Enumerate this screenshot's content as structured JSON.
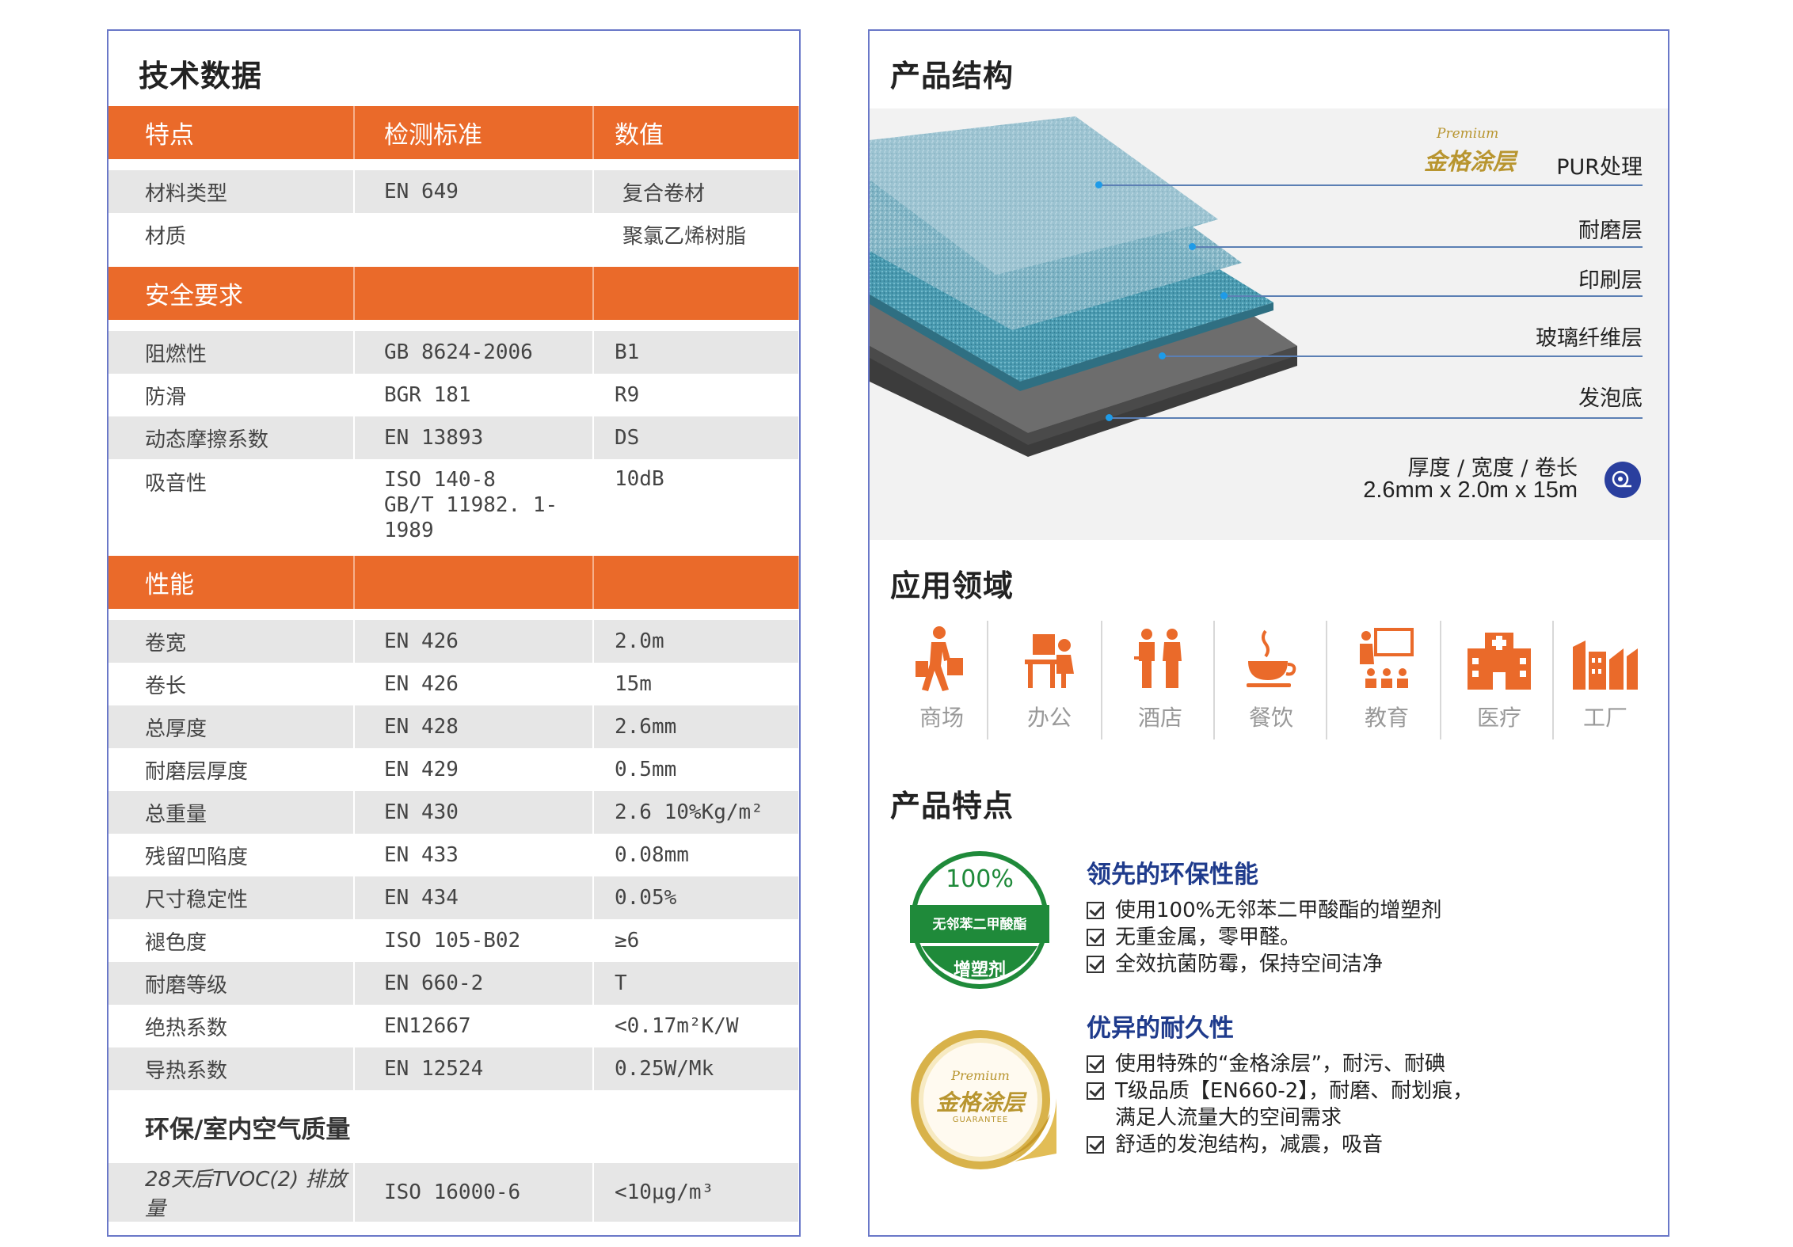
{
  "left": {
    "title": "技术数据",
    "header": [
      "特点",
      "检测标准",
      "数值"
    ],
    "material_rows": [
      {
        "feature": "材料类型",
        "standard": "EN 649",
        "value": "复合卷材"
      },
      {
        "feature": "材质",
        "standard": "",
        "value": "聚氯乙烯树脂"
      }
    ],
    "safety_title": "安全要求",
    "safety_rows": [
      {
        "feature": "阻燃性",
        "standard": "GB 8624-2006",
        "value": "B1"
      },
      {
        "feature": "防滑",
        "standard": "BGR 181",
        "value": "R9"
      },
      {
        "feature": "动态摩擦系数",
        "standard": "EN 13893",
        "value": "DS"
      },
      {
        "feature": "吸音性",
        "standard": "ISO 140-8",
        "standard2": "GB/T 11982. 1-1989",
        "value": "10dB"
      }
    ],
    "performance_title": "性能",
    "performance_rows": [
      {
        "feature": "卷宽",
        "standard": "EN 426",
        "value": "2.0m"
      },
      {
        "feature": "卷长",
        "standard": "EN 426",
        "value": "15m"
      },
      {
        "feature": "总厚度",
        "standard": "EN 428",
        "value": "2.6mm"
      },
      {
        "feature": "耐磨层厚度",
        "standard": "EN 429",
        "value": "0.5mm"
      },
      {
        "feature": "总重量",
        "standard": "EN 430",
        "value": "2.6  10%Kg/m²"
      },
      {
        "feature": "残留凹陷度",
        "standard": "EN 433",
        "value": "0.08mm"
      },
      {
        "feature": "尺寸稳定性",
        "standard": "EN 434",
        "value": "0.05%"
      },
      {
        "feature": "褪色度",
        "standard": "ISO 105-B02",
        "value": "≥6"
      },
      {
        "feature": "耐磨等级",
        "standard": "EN 660-2",
        "value": "T"
      },
      {
        "feature": "绝热系数",
        "standard": "EN12667",
        "value": "<0.17m²K/W"
      },
      {
        "feature": "导热系数",
        "standard": "EN 12524",
        "value": "0.25W/Mk"
      }
    ],
    "env_title": "环保/室内空气质量",
    "env_rows": [
      {
        "feature": "28天后TVOC(2) 排放量",
        "standard": "ISO 16000-6",
        "value": "<10μg/m³"
      }
    ]
  },
  "right": {
    "structure_title": "产品结构",
    "brand_latin": "Premium",
    "brand_cn": "金格涂层",
    "layers": [
      "PUR处理",
      "耐磨层",
      "印刷层",
      "玻璃纤维层",
      "发泡底"
    ],
    "dims_label": "厚度 / 宽度 / 卷长",
    "dims_value": "2.6mm x 2.0m x 15m",
    "application_title": "应用领域",
    "applications": [
      {
        "label": "商场",
        "icon": "shopping-icon"
      },
      {
        "label": "办公",
        "icon": "office-icon"
      },
      {
        "label": "酒店",
        "icon": "hotel-icon"
      },
      {
        "label": "餐饮",
        "icon": "dining-icon"
      },
      {
        "label": "教育",
        "icon": "education-icon"
      },
      {
        "label": "医疗",
        "icon": "hospital-icon"
      },
      {
        "label": "工厂",
        "icon": "factory-icon"
      }
    ],
    "features_title": "产品特点",
    "badge1": {
      "pct": "100%",
      "mid": "无邻苯二甲酸酯",
      "bottom": "增塑剂"
    },
    "badge2": {
      "latin": "Premium",
      "cn": "金格涂层",
      "small": "GUARANTEE"
    },
    "feature_groups": [
      {
        "title": "领先的环保性能",
        "lines": [
          "使用100%无邻苯二甲酸酯的增塑剂",
          "无重金属，零甲醛。",
          "全效抗菌防霉，保持空间洁净"
        ]
      },
      {
        "title": "优异的耐久性",
        "lines": [
          "使用特殊的“金格涂层”，耐污、耐碘",
          "T级品质【EN660-2】，耐磨、耐划痕，",
          "满足人流量大的空间需求",
          "舒适的发泡结构，减震，吸音"
        ]
      }
    ],
    "colors": {
      "accent": "#ea6a2a",
      "navy": "#1f3b8c",
      "green": "#1f8a3a",
      "gold": "#c9a036"
    }
  }
}
